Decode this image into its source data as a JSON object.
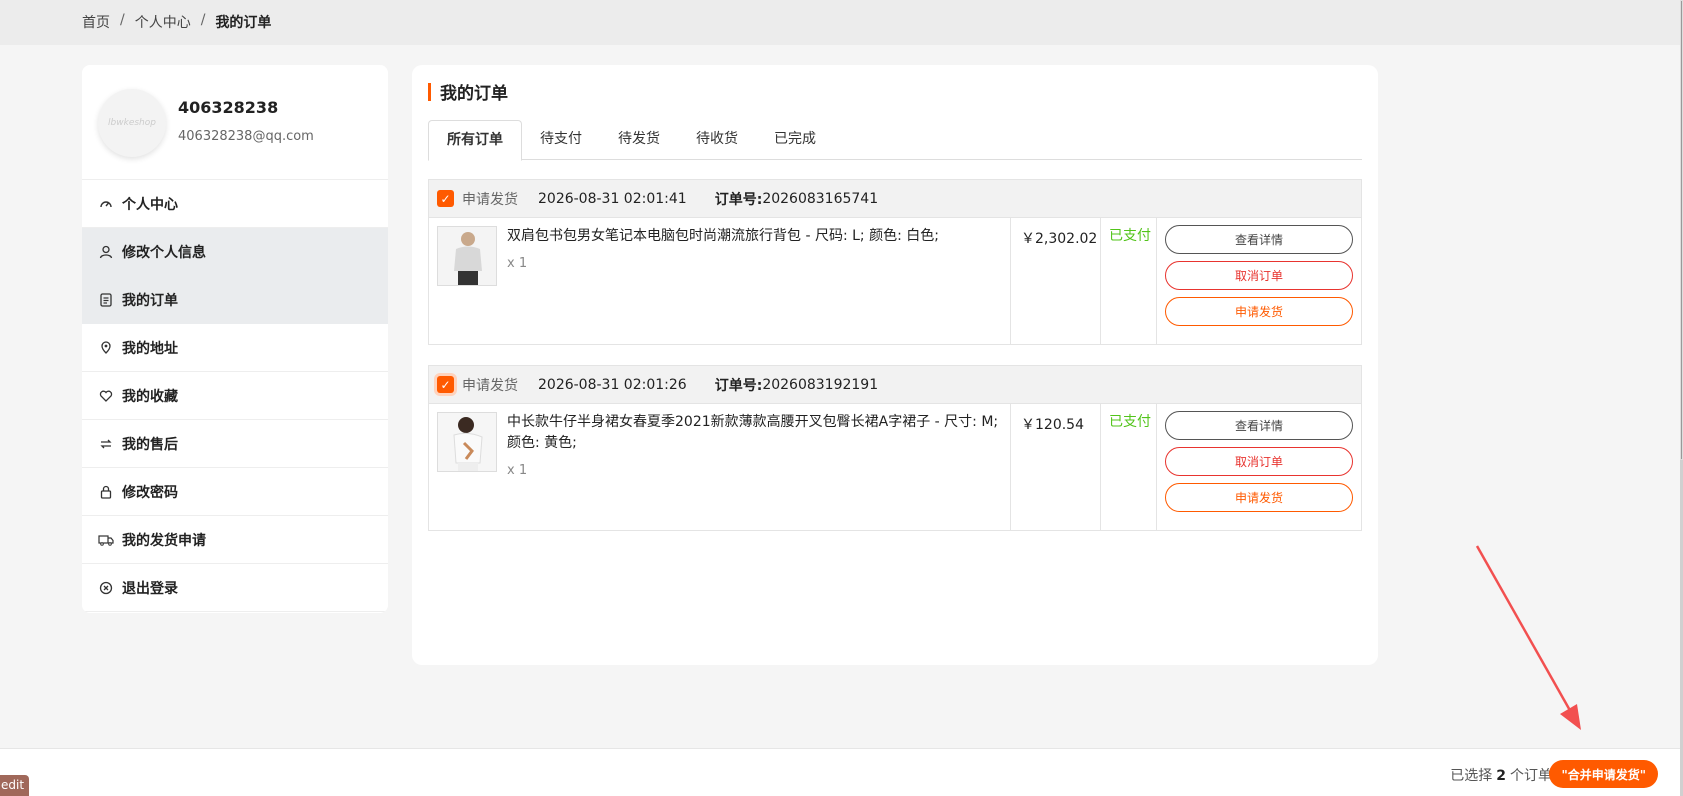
{
  "breadcrumb": {
    "home": "首页",
    "center": "个人中心",
    "current": "我的订单",
    "sep": "/"
  },
  "user": {
    "name": "406328238",
    "email": "406328238@qq.com",
    "avatar_text": "lbwkeshop"
  },
  "sidebar": {
    "items": [
      {
        "label": "个人中心",
        "icon": "dashboard-icon"
      },
      {
        "label": "修改个人信息",
        "icon": "user-icon"
      },
      {
        "label": "我的订单",
        "icon": "document-icon"
      },
      {
        "label": "我的地址",
        "icon": "location-icon"
      },
      {
        "label": "我的收藏",
        "icon": "heart-icon"
      },
      {
        "label": "我的售后",
        "icon": "exchange-icon"
      },
      {
        "label": "修改密码",
        "icon": "lock-icon"
      },
      {
        "label": "我的发货申请",
        "icon": "truck-icon"
      },
      {
        "label": "退出登录",
        "icon": "close-circle-icon"
      }
    ]
  },
  "main": {
    "title": "我的订单",
    "tabs": [
      "所有订单",
      "待支付",
      "待发货",
      "待收货",
      "已完成"
    ]
  },
  "orders": [
    {
      "apply_label": "申请发货",
      "time": "2026-08-31 02:01:41",
      "number_label": "订单号:",
      "number": "2026083165741",
      "product": "双肩包书包男女笔记本电脑包时尚潮流旅行背包 - 尺码: L; 颜色: 白色;",
      "qty": "x 1",
      "price": "￥2,302.02",
      "status": "已支付",
      "actions": {
        "detail": "查看详情",
        "cancel": "取消订单",
        "apply": "申请发货"
      }
    },
    {
      "apply_label": "申请发货",
      "time": "2026-08-31 02:01:26",
      "number_label": "订单号:",
      "number": "2026083192191",
      "product": "中长款牛仔半身裙女春夏季2021新款薄款高腰开叉包臀长裙A字裙子 - 尺寸: M; 颜色: 黄色;",
      "qty": "x 1",
      "price": "￥120.54",
      "status": "已支付",
      "actions": {
        "detail": "查看详情",
        "cancel": "取消订单",
        "apply": "申请发货"
      }
    }
  ],
  "footer": {
    "selected_prefix": "已选择",
    "selected_count": "2",
    "selected_suffix": "个订单",
    "merge_button": "\"合并申请发货\""
  },
  "edit_tab": "edit",
  "colors": {
    "accent": "#ff5a00",
    "paid": "#52c41a",
    "danger": "#e8342f"
  }
}
